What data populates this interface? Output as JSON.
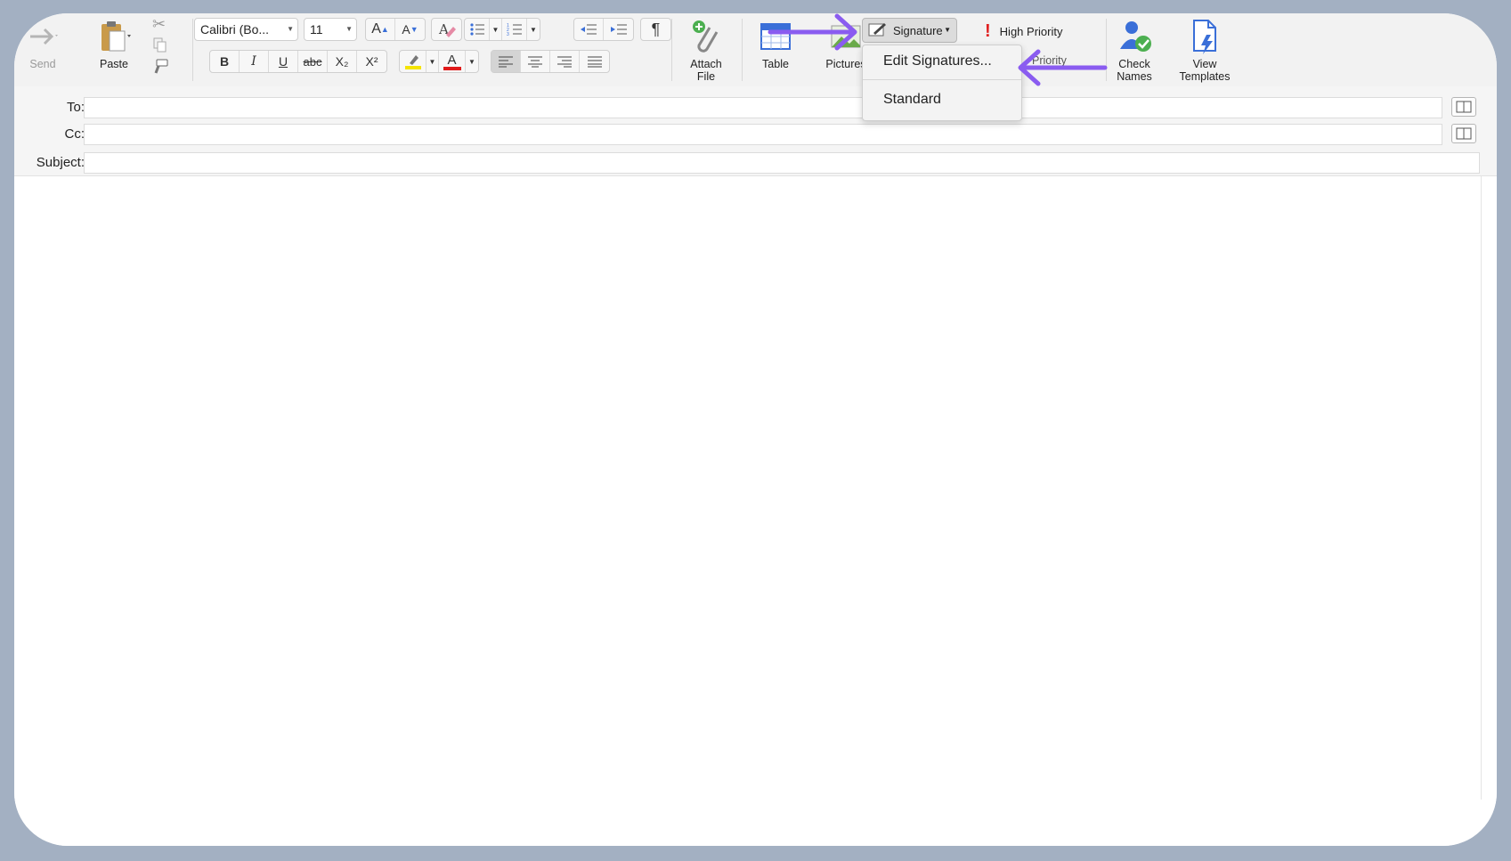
{
  "ribbon": {
    "send_label": "Send",
    "paste_label": "Paste",
    "font_name": "Calibri (Bo...",
    "font_size": "11",
    "attach_label_1": "Attach",
    "attach_label_2": "File",
    "table_label": "Table",
    "pictures_label": "Pictures",
    "signature_label": "Signature",
    "high_priority_label": "High Priority",
    "low_priority_label": "Priority",
    "check_names_label_1": "Check",
    "check_names_label_2": "Names",
    "view_templates_label_1": "View",
    "view_templates_label_2": "Templates",
    "format": {
      "bold": "B",
      "italic": "I",
      "underline": "U",
      "strike": "abc",
      "subscript": "X₂",
      "superscript": "X²",
      "pilcrow": "¶",
      "font_color_letter": "A"
    }
  },
  "signature_menu": {
    "items": [
      "Edit Signatures...",
      "Standard"
    ]
  },
  "fields": {
    "to_label": "To:",
    "cc_label": "Cc:",
    "subject_label": "Subject:",
    "to_value": "",
    "cc_value": "",
    "subject_value": ""
  },
  "colors": {
    "annotation_arrow": "#8a5cf0",
    "highlight_yellow": "#f5e400",
    "font_color_red": "#e01a1a",
    "frame_background": "#a3b0c2"
  }
}
